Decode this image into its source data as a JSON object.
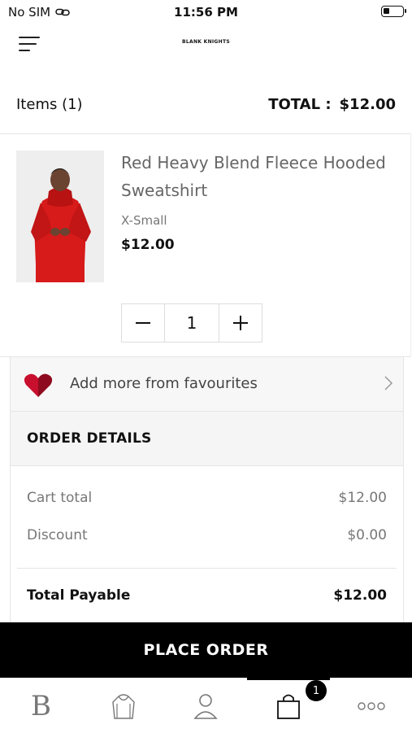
{
  "status_bar": {
    "carrier": "No SIM",
    "time": "11:56 PM"
  },
  "brand": {
    "logo_text": "BLANK KNIGHTS"
  },
  "cart": {
    "items_label": "Items (1)",
    "total_label": "TOTAL :",
    "total_value": "$12.00"
  },
  "product": {
    "name": "Red Heavy Blend Fleece Hooded Sweatshirt",
    "size": "X-Small",
    "price": "$12.00",
    "quantity": "1",
    "image_color": "#d71a1a"
  },
  "favourites": {
    "label": "Add more from favourites"
  },
  "order_details": {
    "heading": "ORDER DETAILS",
    "cart_total_label": "Cart total",
    "cart_total_value": "$12.00",
    "discount_label": "Discount",
    "discount_value": "$0.00",
    "total_payable_label": "Total Payable",
    "total_payable_value": "$12.00"
  },
  "place_order": {
    "label": "PLACE ORDER"
  },
  "tab_bar": {
    "tabs": [
      {
        "icon": "home-b-icon",
        "letter": "B"
      },
      {
        "icon": "hoodie-icon"
      },
      {
        "icon": "user-icon"
      },
      {
        "icon": "bag-icon",
        "active": true
      },
      {
        "icon": "more-icon"
      }
    ],
    "bag_badge": "1"
  },
  "colors": {
    "accent": "#000000",
    "heart": "#c8102e"
  }
}
